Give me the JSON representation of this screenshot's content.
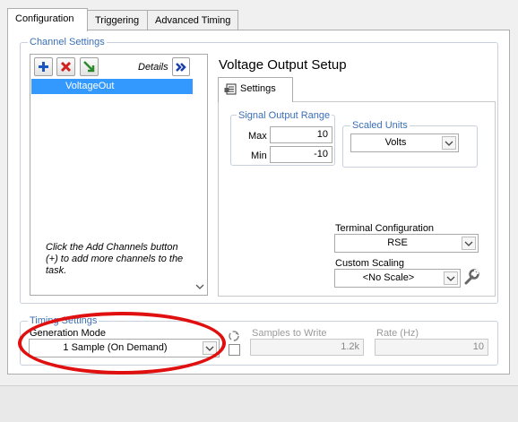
{
  "tabs": [
    {
      "label": "Configuration",
      "active": true
    },
    {
      "label": "Triggering",
      "active": false
    },
    {
      "label": "Advanced Timing",
      "active": false
    }
  ],
  "channel_settings": {
    "title": "Channel Settings",
    "details_label": "Details",
    "channels": [
      "VoltageOut"
    ],
    "hint": "Click the Add Channels button (+) to add more channels to the task."
  },
  "voltage_setup": {
    "title": "Voltage Output Setup",
    "settings_tab": "Settings",
    "signal_output_range": {
      "title": "Signal Output Range",
      "max_label": "Max",
      "max_value": "10",
      "min_label": "Min",
      "min_value": "-10"
    },
    "scaled_units": {
      "title": "Scaled Units",
      "value": "Volts"
    },
    "terminal_configuration": {
      "label": "Terminal Configuration",
      "value": "RSE"
    },
    "custom_scaling": {
      "label": "Custom Scaling",
      "value": "<No Scale>"
    }
  },
  "timing_settings": {
    "title": "Timing Settings",
    "generation_mode_label": "Generation Mode",
    "generation_mode_value": "1 Sample (On Demand)",
    "samples_to_write_label": "Samples to Write",
    "samples_to_write_value": "1.2k",
    "rate_label": "Rate (Hz)",
    "rate_value": "10"
  },
  "colors": {
    "group_label": "#3b6fb6",
    "selection": "#3399ff",
    "annotation": "#e01010"
  }
}
